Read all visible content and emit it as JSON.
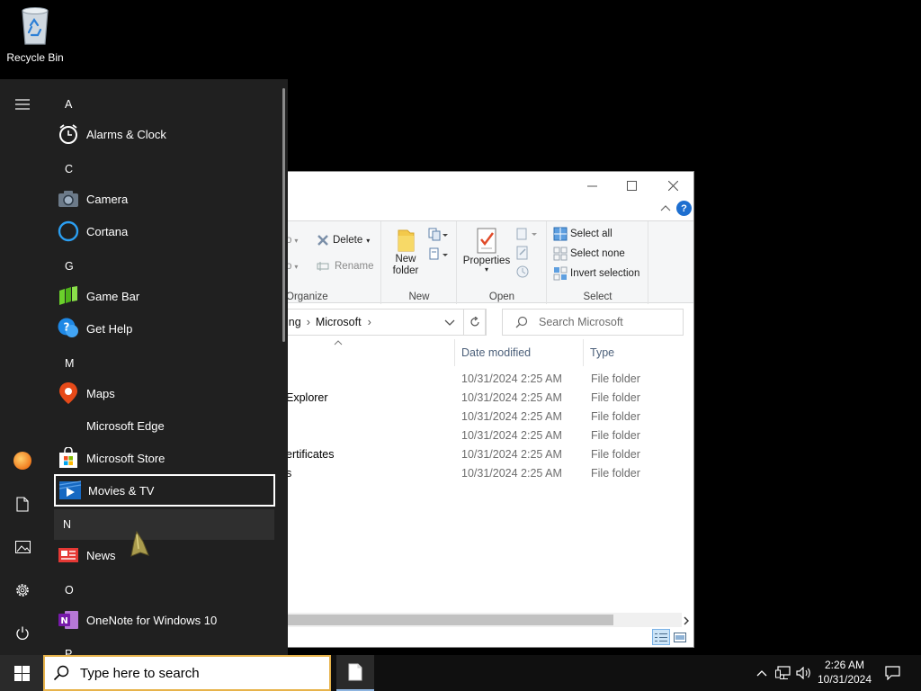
{
  "desktop": {
    "recycle_bin_label": "Recycle Bin"
  },
  "explorer": {
    "ribbon": {
      "organize": {
        "move_to_partial": "o",
        "copy_to_partial": "o",
        "delete_label": "Delete",
        "rename_label": "Rename",
        "group_label": "Organize"
      },
      "new": {
        "new_folder_line1": "New",
        "new_folder_line2": "folder",
        "group_label": "New"
      },
      "open": {
        "properties_label": "Properties",
        "group_label": "Open"
      },
      "select": {
        "select_all": "Select all",
        "select_none": "Select none",
        "invert_selection": "Invert selection",
        "group_label": "Select"
      }
    },
    "address": {
      "crumb_partial": "ing",
      "crumb": "Microsoft"
    },
    "search_placeholder": "Search Microsoft",
    "columns": {
      "date_modified": "Date modified",
      "type": "Type"
    },
    "rows": [
      {
        "name": "",
        "date": "10/31/2024 2:25 AM",
        "type": "File folder"
      },
      {
        "name": "Explorer",
        "date": "10/31/2024 2:25 AM",
        "type": "File folder"
      },
      {
        "name": "",
        "date": "10/31/2024 2:25 AM",
        "type": "File folder"
      },
      {
        "name": "",
        "date": "10/31/2024 2:25 AM",
        "type": "File folder"
      },
      {
        "name": "ertificates",
        "date": "10/31/2024 2:25 AM",
        "type": "File folder"
      },
      {
        "name": "s",
        "date": "10/31/2024 2:25 AM",
        "type": "File folder"
      }
    ]
  },
  "start_menu": {
    "letters": {
      "a": "A",
      "c": "C",
      "g": "G",
      "m": "M",
      "n": "N",
      "o": "O",
      "p": "P"
    },
    "apps": {
      "alarms": "Alarms & Clock",
      "camera": "Camera",
      "cortana": "Cortana",
      "gamebar": "Game Bar",
      "gethelp": "Get Help",
      "maps": "Maps",
      "edge": "Microsoft Edge",
      "store": "Microsoft Store",
      "movies": "Movies & TV",
      "news": "News",
      "onenote": "OneNote for Windows 10"
    }
  },
  "taskbar": {
    "search_placeholder": "Type here to search",
    "time": "2:26 AM",
    "date": "10/31/2024"
  },
  "colors": {
    "accent": "#0078d7",
    "start_bg": "#202020",
    "taskbar_bg": "#101010",
    "search_border": "#e7b34b"
  }
}
